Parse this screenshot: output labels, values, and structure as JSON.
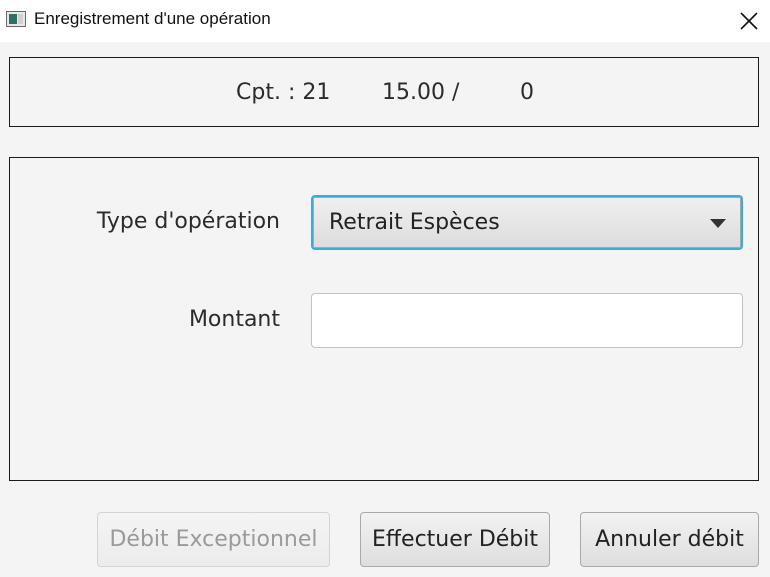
{
  "window": {
    "title": "Enregistrement d'une opération",
    "app_icon": "window-app-icon",
    "close_icon": "close-icon"
  },
  "summary": {
    "account": "Cpt. : 21",
    "balance": "15.00",
    "separator": "/",
    "other": "0"
  },
  "form": {
    "type_label": "Type d'opération",
    "type_value": "Retrait Espèces",
    "amount_label": "Montant",
    "amount_value": ""
  },
  "buttons": {
    "exceptional": "Débit Exceptionnel",
    "exceptional_enabled": false,
    "debit": "Effectuer Débit",
    "cancel": "Annuler débit"
  },
  "colors": {
    "focus_accent": "#3bacd9",
    "panel_border": "#1a1a1a",
    "background": "#f4f4f4"
  }
}
